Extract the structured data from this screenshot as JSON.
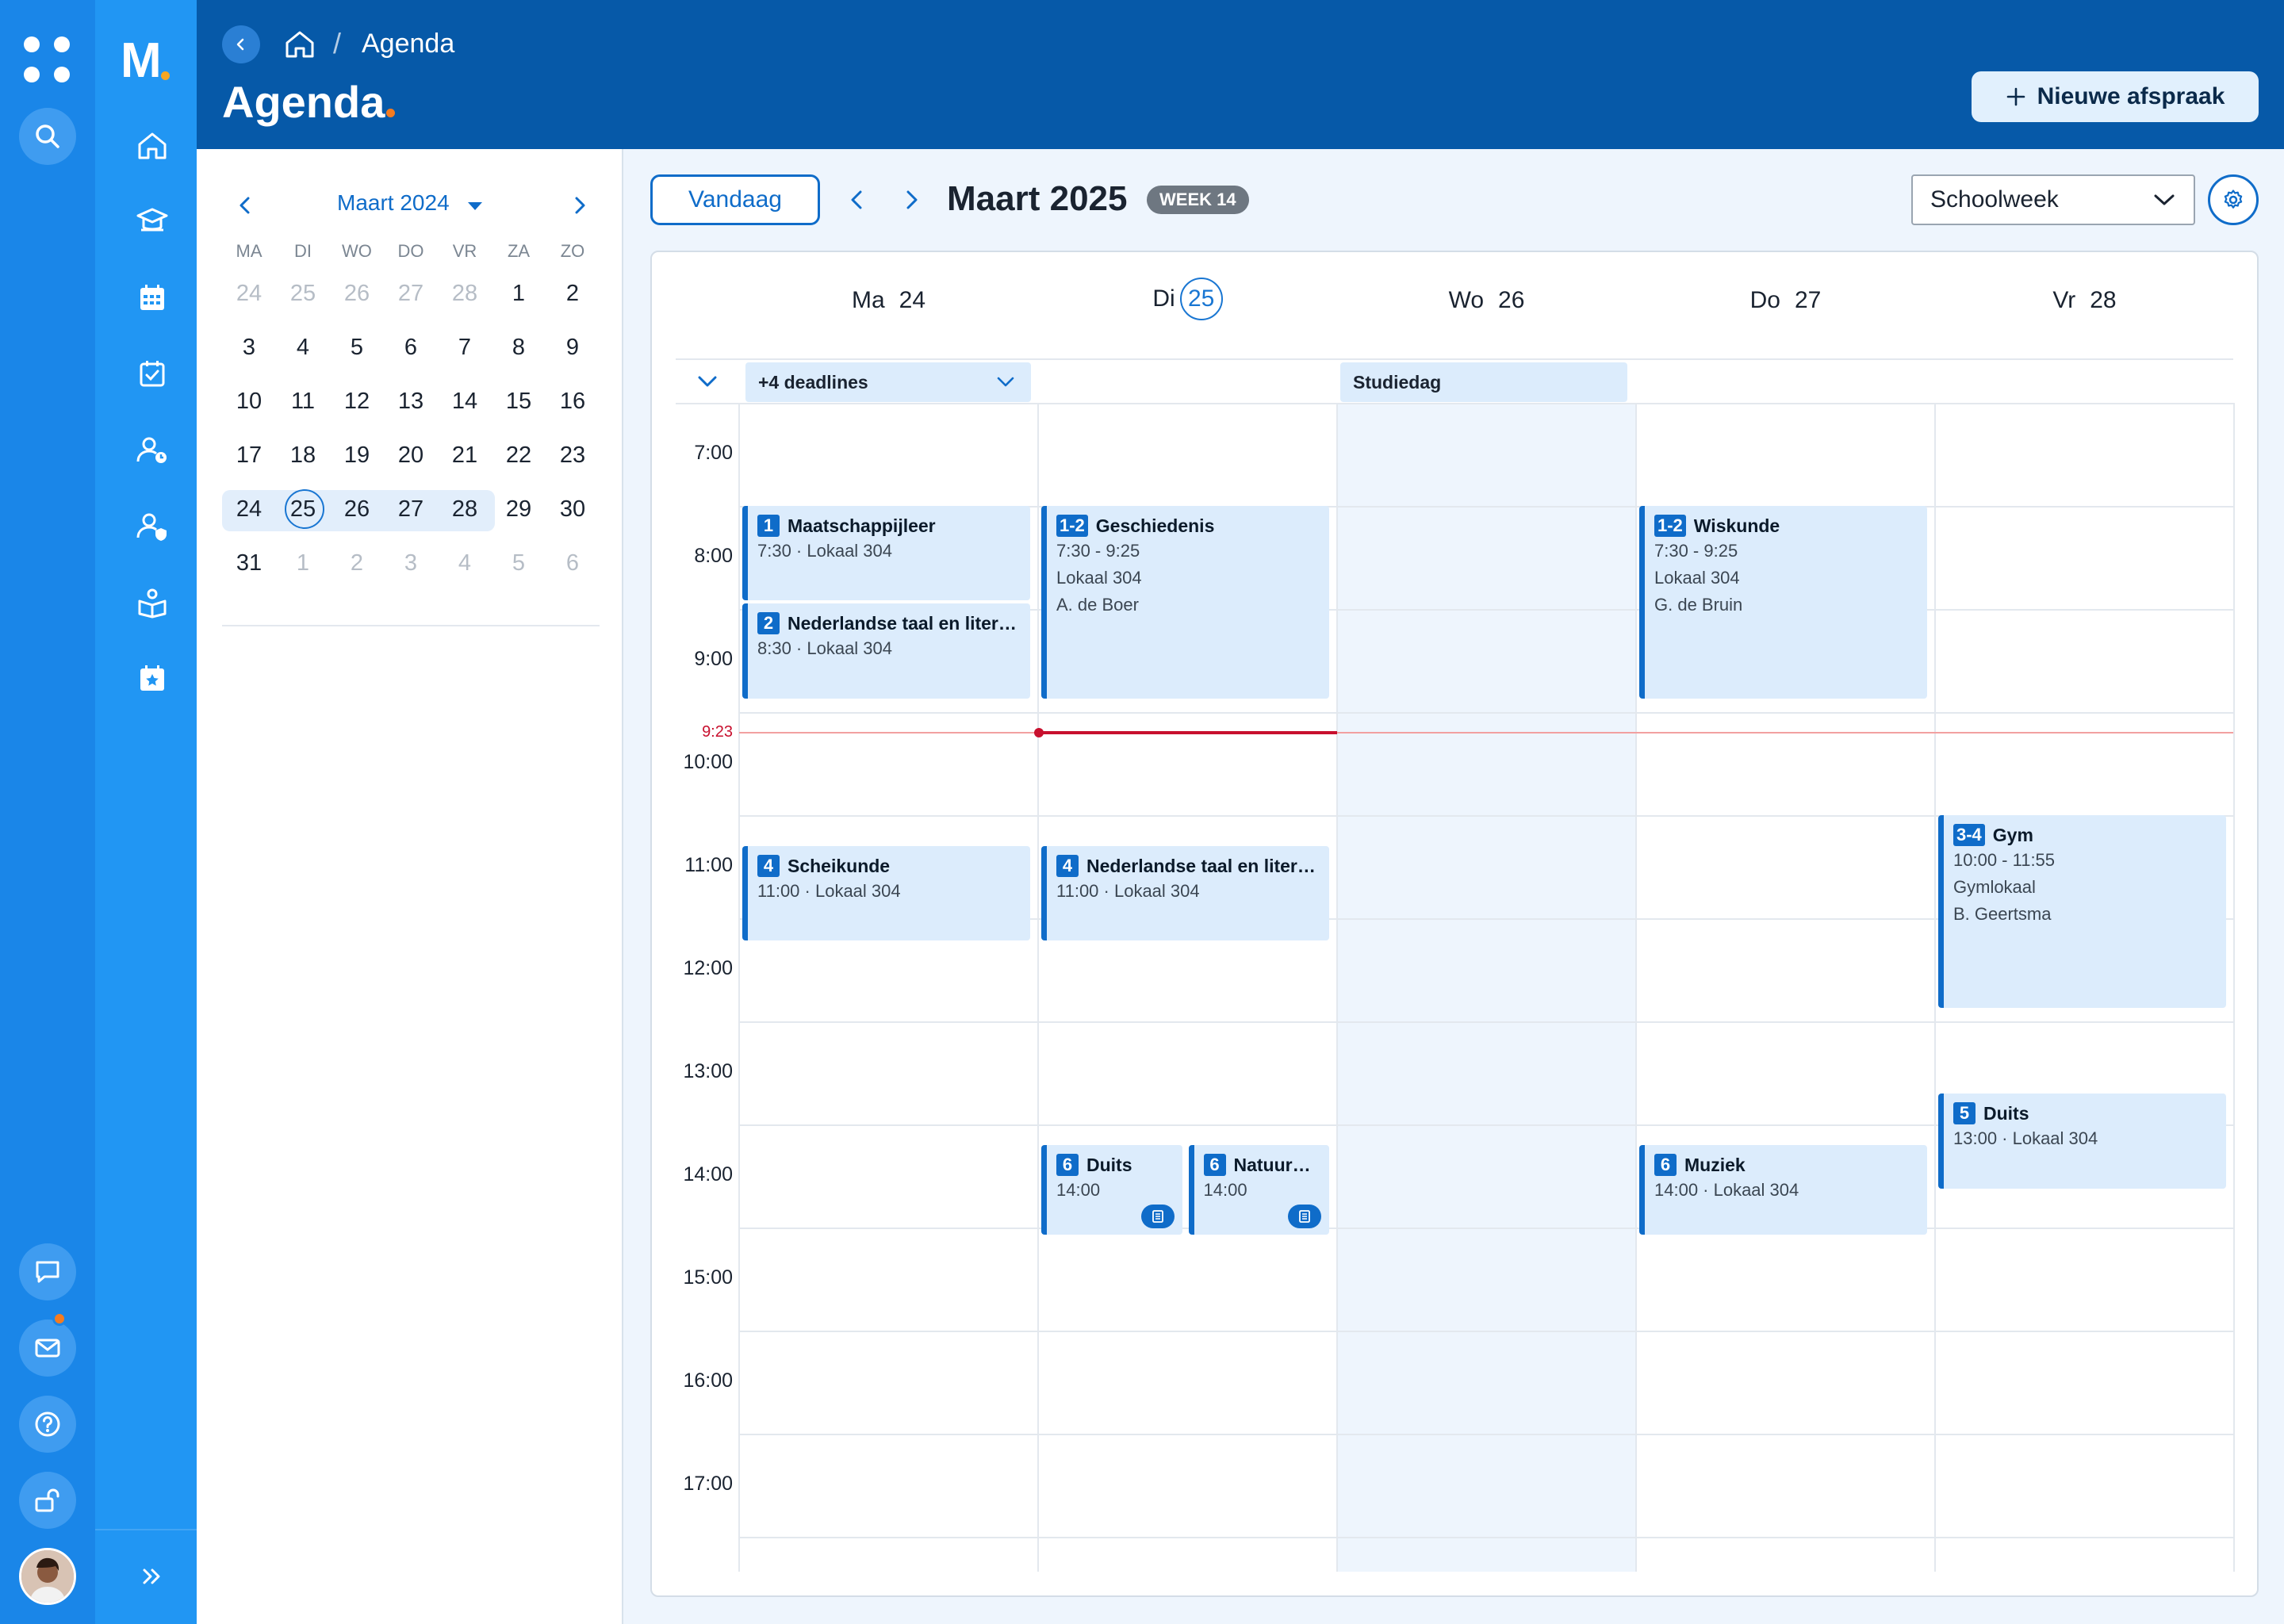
{
  "app": {
    "logo": "M",
    "breadcrumb_current": "Agenda",
    "breadcrumb_sep": "/",
    "page_title": "Agenda",
    "new_appointment_label": "Nieuwe afspraak"
  },
  "mini_calendar": {
    "month_label": "Maart 2024",
    "weekdays": [
      "MA",
      "DI",
      "WO",
      "DO",
      "VR",
      "ZA",
      "ZO"
    ],
    "weeks": [
      [
        {
          "d": "24",
          "m": true
        },
        {
          "d": "25",
          "m": true
        },
        {
          "d": "26",
          "m": true
        },
        {
          "d": "27",
          "m": true
        },
        {
          "d": "28",
          "m": true
        },
        {
          "d": "1",
          "m": false
        },
        {
          "d": "2",
          "m": false
        }
      ],
      [
        {
          "d": "3"
        },
        {
          "d": "4"
        },
        {
          "d": "5"
        },
        {
          "d": "6"
        },
        {
          "d": "7"
        },
        {
          "d": "8"
        },
        {
          "d": "9"
        }
      ],
      [
        {
          "d": "10"
        },
        {
          "d": "11"
        },
        {
          "d": "12"
        },
        {
          "d": "13"
        },
        {
          "d": "14"
        },
        {
          "d": "15"
        },
        {
          "d": "16"
        }
      ],
      [
        {
          "d": "17"
        },
        {
          "d": "18"
        },
        {
          "d": "19"
        },
        {
          "d": "20"
        },
        {
          "d": "21"
        },
        {
          "d": "22"
        },
        {
          "d": "23"
        }
      ],
      [
        {
          "d": "24"
        },
        {
          "d": "25",
          "today": true
        },
        {
          "d": "26"
        },
        {
          "d": "27"
        },
        {
          "d": "28"
        },
        {
          "d": "29"
        },
        {
          "d": "30"
        }
      ],
      [
        {
          "d": "31"
        },
        {
          "d": "1",
          "m": true
        },
        {
          "d": "2",
          "m": true
        },
        {
          "d": "3",
          "m": true
        },
        {
          "d": "4",
          "m": true
        },
        {
          "d": "5",
          "m": true
        },
        {
          "d": "6",
          "m": true
        }
      ]
    ]
  },
  "toolbar": {
    "today_label": "Vandaag",
    "month_title": "Maart 2025",
    "week_badge": "WEEK 14",
    "view_select": "Schoolweek"
  },
  "days": [
    {
      "dow": "Ma",
      "num": "24",
      "today": false
    },
    {
      "dow": "Di",
      "num": "25",
      "today": true
    },
    {
      "dow": "Wo",
      "num": "26",
      "today": false
    },
    {
      "dow": "Do",
      "num": "27",
      "today": false
    },
    {
      "dow": "Vr",
      "num": "28",
      "today": false
    }
  ],
  "all_day": {
    "deadlines_label": "+4 deadlines",
    "wednesday_label": "Studiedag"
  },
  "times": [
    "7:00",
    "8:00",
    "9:00",
    "10:00",
    "11:00",
    "12:00",
    "13:00",
    "14:00",
    "15:00",
    "16:00",
    "17:00"
  ],
  "now_label": "9:23",
  "events": [
    {
      "day": 0,
      "badge": "1",
      "title": "Maatschappijleer",
      "lines": [
        "7:30 · Lokaal 304"
      ]
    },
    {
      "day": 0,
      "badge": "2",
      "title": "Nederlandse taal en literatuur",
      "lines": [
        "8:30 · Lokaal 304"
      ]
    },
    {
      "day": 0,
      "badge": "4",
      "title": "Scheikunde",
      "lines": [
        "11:00 · Lokaal 304"
      ]
    },
    {
      "day": 1,
      "badge": "1-2",
      "title": "Geschiedenis",
      "lines": [
        "7:30 - 9:25",
        "Lokaal 304",
        "A. de Boer"
      ]
    },
    {
      "day": 1,
      "badge": "4",
      "title": "Nederlandse taal en literatuur",
      "lines": [
        "11:00 · Lokaal 304"
      ]
    },
    {
      "day": 1,
      "badge": "6",
      "title": "Duits",
      "lines": [
        "14:00"
      ],
      "note": true
    },
    {
      "day": 1,
      "badge": "6",
      "title": "Natuurkunde",
      "lines": [
        "14:00"
      ],
      "note": true
    },
    {
      "day": 3,
      "badge": "1-2",
      "title": "Wiskunde",
      "lines": [
        "7:30 - 9:25",
        "Lokaal 304",
        "G. de Bruin"
      ]
    },
    {
      "day": 3,
      "badge": "6",
      "title": "Muziek",
      "lines": [
        "14:00 · Lokaal 304"
      ]
    },
    {
      "day": 4,
      "badge": "3-4",
      "title": "Gym",
      "lines": [
        "10:00 - 11:55",
        "Gymlokaal",
        "B. Geertsma"
      ]
    },
    {
      "day": 4,
      "badge": "5",
      "title": "Duits",
      "lines": [
        "13:00 · Lokaal 304"
      ]
    }
  ],
  "colors": {
    "primary": "#0f6cc9",
    "header": "#0659a8",
    "rail": "#1a86e8",
    "event_bg": "#dcecfc",
    "now_line": "#c8102e",
    "accent_orange": "#f47b20"
  }
}
